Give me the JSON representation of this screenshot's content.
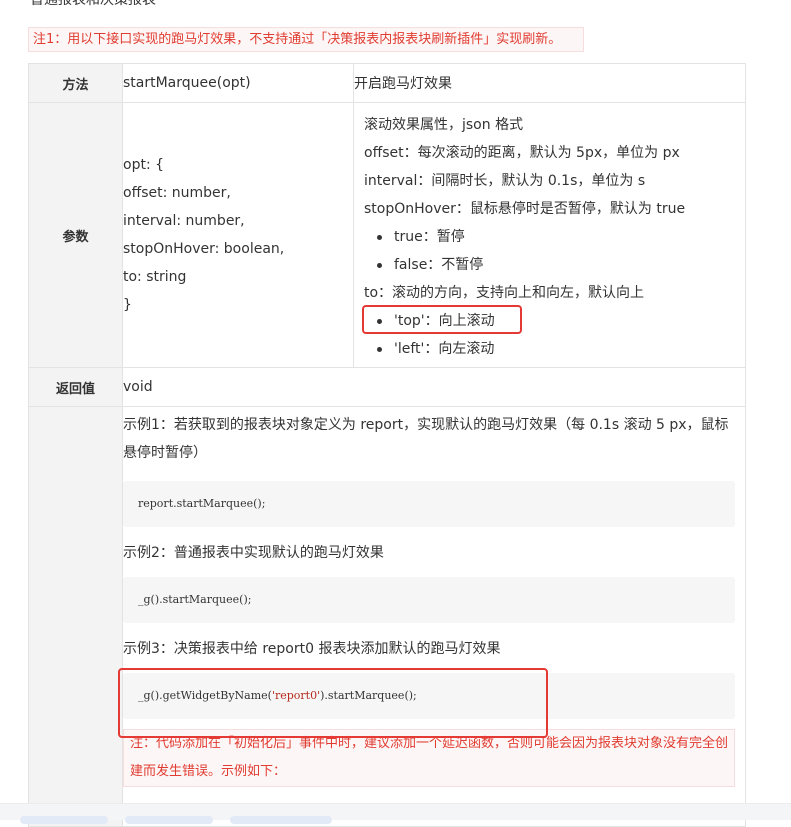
{
  "heading_partial": "普通报表和决策报表",
  "top_note": "注1：用以下接口实现的跑马灯效果，不支持通过「决策报表内报表块刷新插件」实现刷新。",
  "table": {
    "method": {
      "label": "方法",
      "name": "startMarquee(opt)",
      "desc": "开启跑马灯效果"
    },
    "params": {
      "label": "参数",
      "signature": [
        "opt: {",
        "offset: number,",
        "interval: number,",
        "stopOnHover: boolean,",
        "to: string",
        "}"
      ],
      "desc_title": "滚动效果属性，json 格式",
      "offset": "offset：每次滚动的距离，默认为 5px，单位为 px",
      "interval": "interval：间隔时长，默认为 0.1s，单位为 s",
      "stopOnHover": "stopOnHover：鼠标悬停时是否暂停，默认为 true",
      "stop_true": "true：暂停",
      "stop_false": "false：不暂停",
      "to": "to：滚动的方向，支持向上和向左，默认向上",
      "to_top": "'top'：向上滚动",
      "to_left": "'left'：向左滚动"
    },
    "returns": {
      "label": "返回值",
      "value": "void"
    },
    "examples": {
      "ex1_text": "示例1：若获取到的报表块对象定义为 report，实现默认的跑马灯效果（每 0.1s 滚动 5 px，鼠标悬停时暂停）",
      "ex1_code": "report.startMarquee();",
      "ex2_text": "示例2：普通报表中实现默认的跑马灯效果",
      "ex2_code": "_g().startMarquee();",
      "ex3_text": "示例3：决策报表中给 report0 报表块添加默认的跑马灯效果",
      "ex3_code_a": "_g().getWidgetByName(",
      "ex3_code_str": "'report0'",
      "ex3_code_b": ").startMarquee();",
      "note": "注：代码添加在「初始化后」事件中时，建议添加一个延迟函数，否则可能会因为报表块对象没有完全创建而发生错误。示例如下："
    }
  },
  "colors": {
    "highlight_box": "#e53935",
    "note_text": "#e03c31",
    "note_bg": "#fdf6f6",
    "header_bg": "#f3f3f3"
  }
}
